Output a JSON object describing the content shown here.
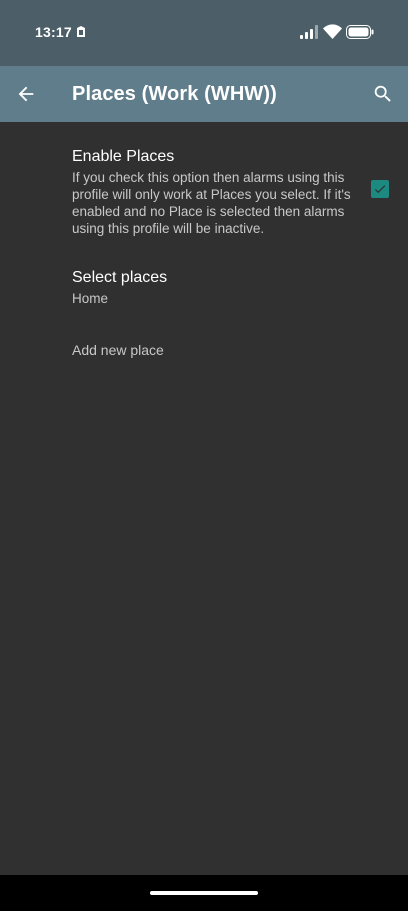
{
  "status_bar": {
    "time": "13:17",
    "notification_icon": "notification-app-icon",
    "signal_icon": "cell-signal-icon",
    "wifi_icon": "wifi-icon",
    "battery_icon": "battery-icon"
  },
  "app_bar": {
    "title": "Places (Work (WHW))",
    "back_icon": "arrow-back-icon",
    "search_icon": "search-icon"
  },
  "preferences": {
    "enable_places": {
      "title": "Enable Places",
      "summary": "If you check this option then alarms using this profile will only work at Places you select. If it's enabled and no Place is selected then alarms using this profile will be inactive.",
      "checked": true
    },
    "select_places": {
      "title": "Select places",
      "value": "Home"
    },
    "add_new_place": {
      "label": "Add new place"
    }
  },
  "colors": {
    "status_bar": "#4c5f69",
    "app_bar": "#607d8b",
    "background": "#303030",
    "accent": "#1d8a81"
  }
}
